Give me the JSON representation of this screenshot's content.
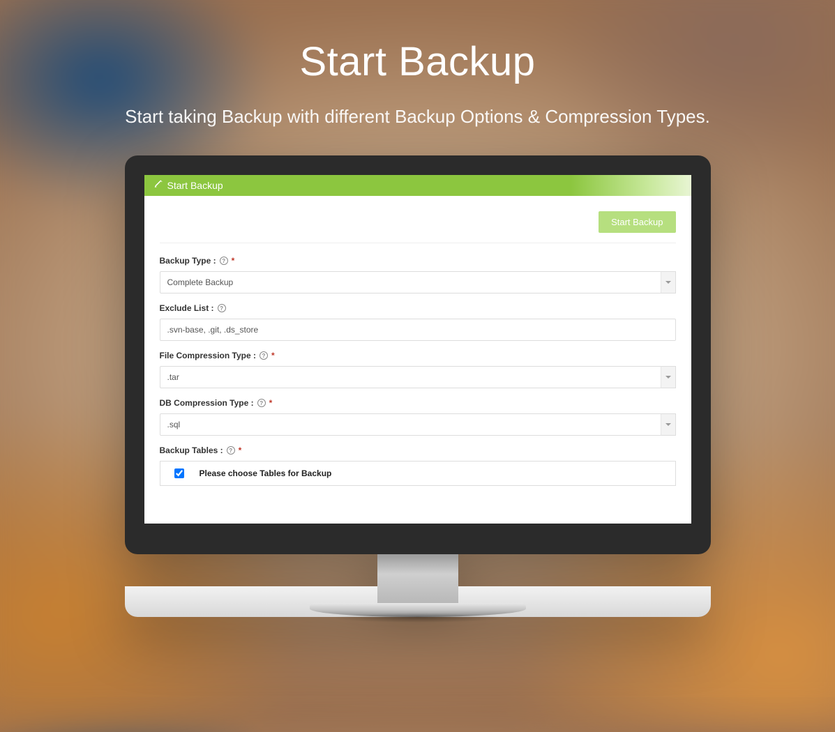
{
  "hero": {
    "title": "Start Backup",
    "subtitle": "Start taking Backup with different Backup Options & Compression Types."
  },
  "panel": {
    "title": "Start Backup",
    "action_button": "Start Backup"
  },
  "form": {
    "backup_type": {
      "label": "Backup Type :",
      "value": "Complete Backup"
    },
    "exclude_list": {
      "label": "Exclude List :",
      "value": ".svn-base, .git, .ds_store"
    },
    "file_compression": {
      "label": "File Compression Type :",
      "value": ".tar"
    },
    "db_compression": {
      "label": "DB Compression Type :",
      "value": ".sql"
    },
    "backup_tables": {
      "label": "Backup Tables :",
      "header": "Please choose Tables for Backup"
    }
  }
}
